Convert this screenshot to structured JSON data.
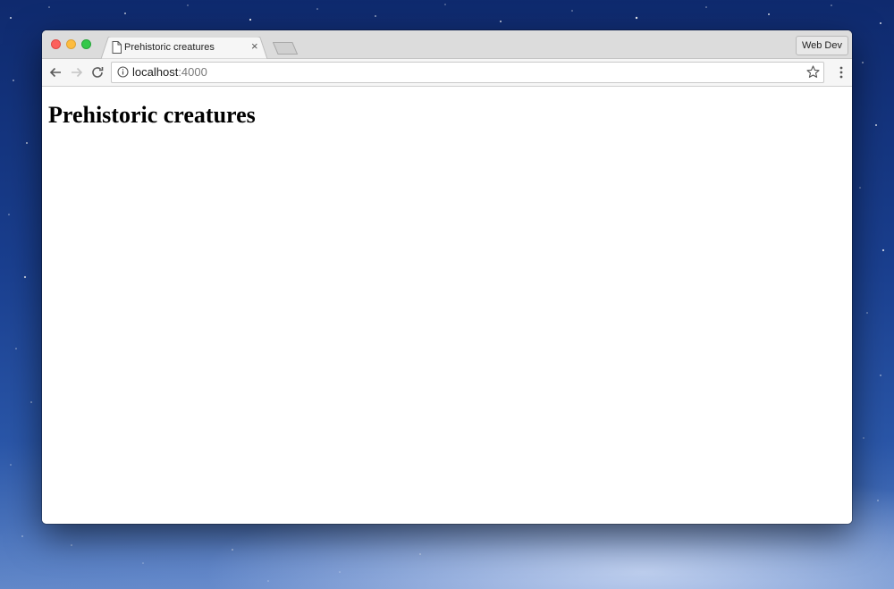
{
  "browser": {
    "tab": {
      "title": "Prehistoric creatures",
      "close_label": "×",
      "favicon_icon": "document-icon"
    },
    "profile_button": "Web Dev",
    "address": {
      "host": "localhost",
      "port": ":4000"
    },
    "icons": {
      "back": "arrow-left-icon",
      "forward": "arrow-right-icon",
      "reload": "reload-icon",
      "info": "info-icon",
      "bookmark": "star-icon",
      "menu": "kebab-menu-icon"
    }
  },
  "page": {
    "heading": "Prehistoric creatures"
  },
  "colors": {
    "traffic_close": "#fc605c",
    "traffic_minimize": "#fdbc40",
    "traffic_maximize": "#34c84a"
  }
}
